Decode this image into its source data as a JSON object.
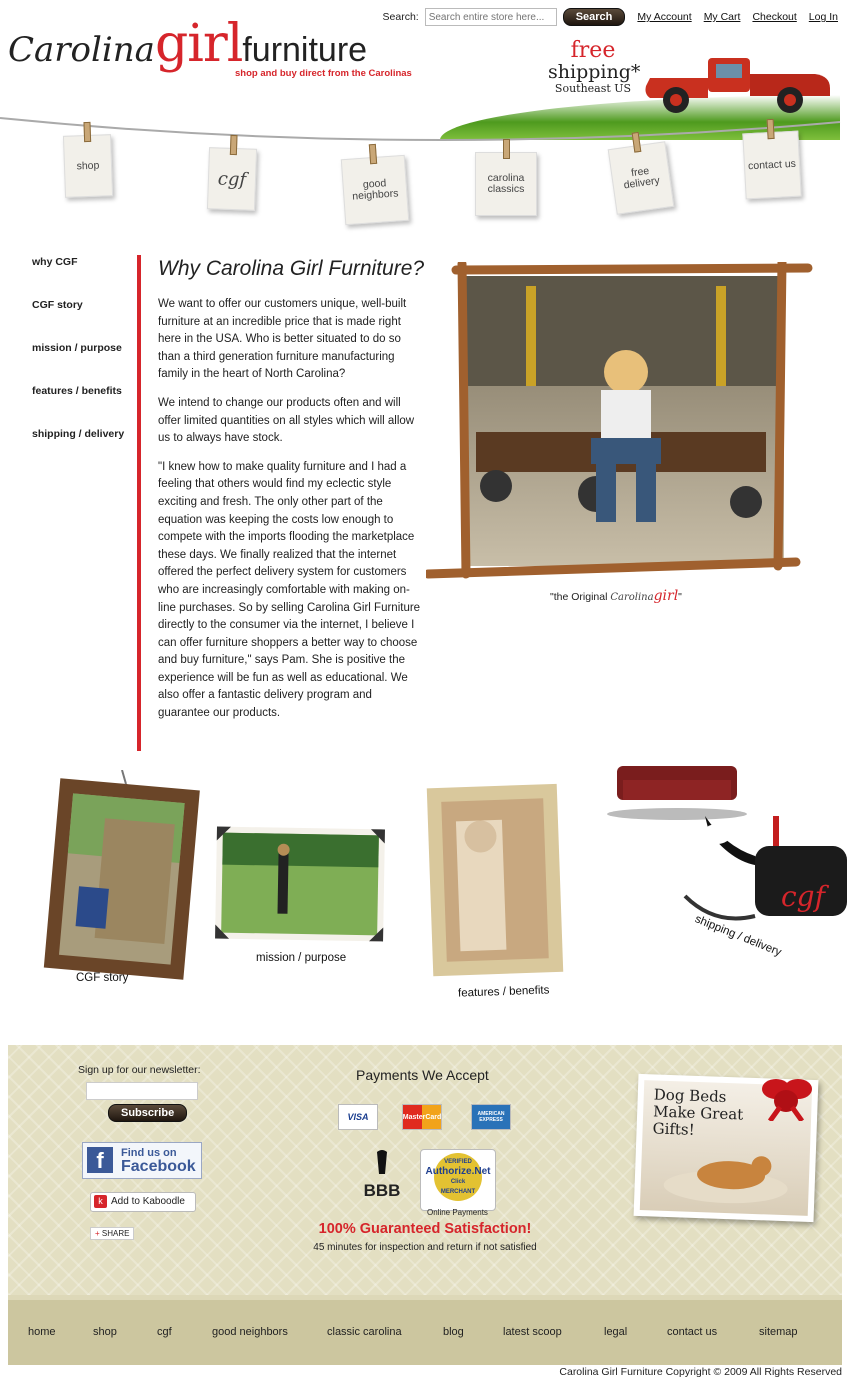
{
  "header": {
    "logo": {
      "carolina": "Carolina",
      "girl": "girl",
      "furniture": "furniture"
    },
    "tagline": "shop and buy direct from the Carolinas",
    "search_label": "Search:",
    "search_placeholder": "Search entire store here...",
    "search_button": "Search",
    "links": [
      "My Account",
      "My Cart",
      "Checkout",
      "Log In"
    ],
    "free_shipping": {
      "free": "free",
      "shipping": "shipping",
      "asterisk": "*",
      "region": "Southeast US"
    }
  },
  "tags": [
    "shop",
    "cgf",
    "good neighbors",
    "carolina classics",
    "free delivery",
    "contact us"
  ],
  "sidenav": [
    "why CGF",
    "CGF story",
    "mission / purpose",
    "features / benefits",
    "shipping / delivery"
  ],
  "main": {
    "title": "Why Carolina Girl Furniture?",
    "paragraphs": [
      "We want to offer our customers unique, well-built furniture at an incredible price that is made right here in the USA. Who is better situated to do so than a third generation furniture manufacturing family in the heart of North Carolina?",
      "We intend to change our products often and will offer limited quantities on all styles which will allow us to always have stock.",
      "\"I knew how to make quality furniture and I had a feeling that others would find my eclectic style exciting and fresh. The only other part of the equation was keeping the costs low enough to compete with the imports flooding the marketplace these days. We finally realized that the internet offered the perfect delivery system for customers who are increasingly comfortable with making on-line purchases. So by selling Carolina Girl Furniture directly to the consumer via the internet, I believe I can offer furniture shoppers a better way to choose and buy furniture,\" says Pam. She is positive the experience will be fun as well as educational. We also offer a fantastic delivery program and guarantee our products."
    ],
    "caption_prefix": "\"the Original ",
    "caption_script": "Carolina",
    "caption_girl": "girl",
    "caption_suffix": "\""
  },
  "photos": [
    "CGF story",
    "mission / purpose",
    "features / benefits",
    "shipping / delivery"
  ],
  "footer": {
    "newsletter_label": "Sign up for our newsletter:",
    "subscribe": "Subscribe",
    "facebook_small": "Find us on",
    "facebook_big": "Facebook",
    "kaboodle": "Add to Kaboodle",
    "share": "SHARE",
    "payments_title": "Payments We Accept",
    "cards": [
      "VISA",
      "MasterCard",
      "AMERICAN EXPRESS"
    ],
    "bbb": "BBB",
    "authnet_top": "VERIFIED",
    "authnet": "Authorize.Net",
    "authnet_click": "Click",
    "authnet_bottom": "MERCHANT",
    "online_payments": "Online Payments",
    "guarantee": "100% Guaranteed Satisfaction!",
    "guarantee_sub": "45 minutes for inspection and return if not satisfied",
    "promo": "Dog Beds Make Great Gifts!",
    "nav": [
      "home",
      "shop",
      "cgf",
      "good neighbors",
      "classic carolina",
      "blog",
      "latest scoop",
      "legal",
      "contact us",
      "sitemap"
    ]
  },
  "copyright": "Carolina Girl Furniture Copyright © 2009 All Rights Reserved",
  "colors": {
    "accent": "#d6252b",
    "footer_bg": "#e3dfc2",
    "footer_nav_bg": "#ccc69f"
  }
}
